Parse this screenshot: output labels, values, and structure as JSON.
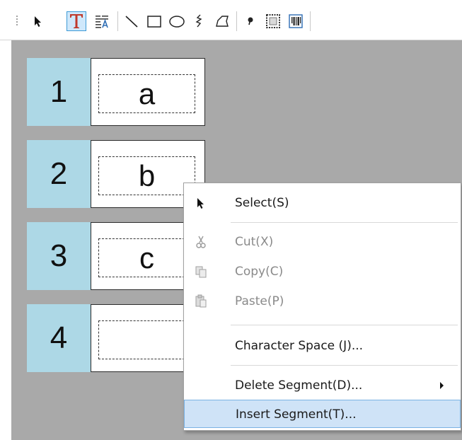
{
  "toolbar": {
    "tools": [
      {
        "name": "select-tool",
        "icon": "pointer-icon"
      },
      {
        "name": "text-tool",
        "icon": "text-t-icon",
        "active": true
      },
      {
        "name": "text-block-tool",
        "icon": "text-block-icon"
      },
      {
        "name": "line-tool",
        "icon": "line-icon"
      },
      {
        "name": "rectangle-tool",
        "icon": "rectangle-icon"
      },
      {
        "name": "ellipse-tool",
        "icon": "ellipse-icon"
      },
      {
        "name": "freehand-tool",
        "icon": "freehand-icon"
      },
      {
        "name": "polygon-tool",
        "icon": "polygon-icon"
      },
      {
        "name": "dot-tool",
        "icon": "dot-icon"
      },
      {
        "name": "image-frame-tool",
        "icon": "image-frame-icon"
      },
      {
        "name": "barcode-tool",
        "icon": "barcode-icon"
      }
    ]
  },
  "segments": [
    {
      "number": "1",
      "text": "a"
    },
    {
      "number": "2",
      "text": "b"
    },
    {
      "number": "3",
      "text": "c"
    },
    {
      "number": "4",
      "text": ""
    }
  ],
  "context_menu": {
    "select": "Select(S)",
    "cut": "Cut(X)",
    "copy": "Copy(C)",
    "paste": "Paste(P)",
    "character_space": "Character Space (J)...",
    "delete_segment": "Delete Segment(D)...",
    "insert_segment": "Insert Segment(T)..."
  },
  "colors": {
    "segment_number_bg": "#add8e6",
    "canvas_bg": "#a9a9a9",
    "menu_highlight": "#cfe3f7",
    "active_tool_border": "#3d9ad6"
  }
}
